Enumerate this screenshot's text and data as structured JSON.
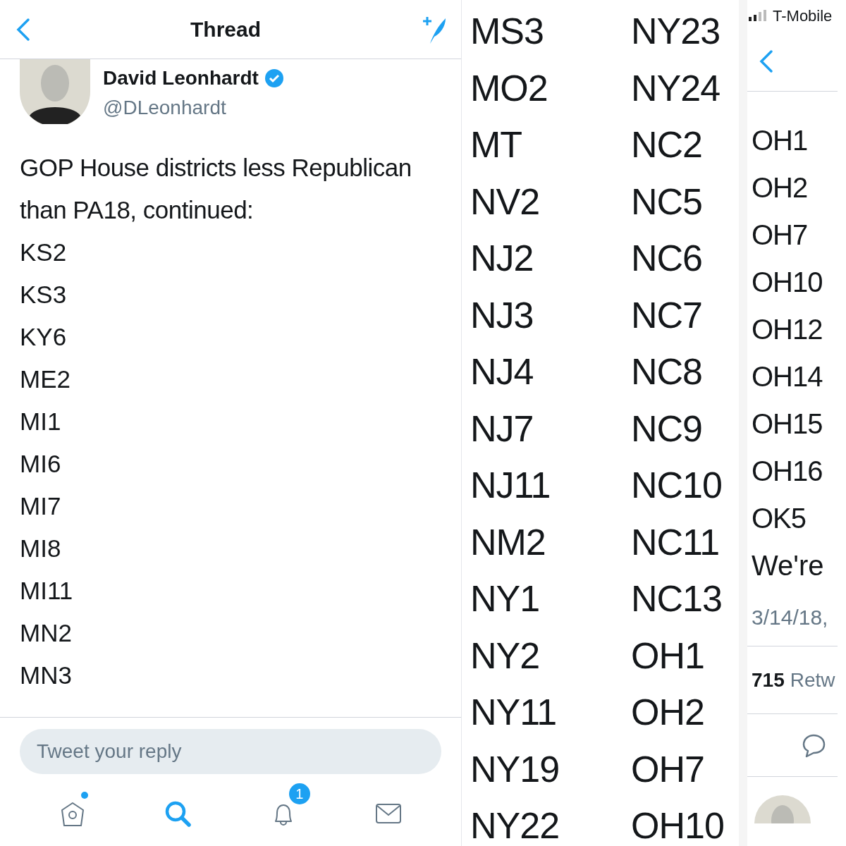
{
  "left_panel": {
    "header": {
      "title": "Thread"
    },
    "tweet": {
      "author": "David Leonhardt",
      "verified": true,
      "handle": "@DLeonhardt",
      "text": "GOP House districts less Republican than PA18, continued:",
      "districts": [
        "KS2",
        "KS3",
        "KY6",
        "ME2",
        "MI1",
        "MI6",
        "MI7",
        "MI8",
        "MI11",
        "MN2",
        "MN3"
      ]
    },
    "reply_box": {
      "placeholder": "Tweet your reply"
    },
    "tab_bar": [
      {
        "kind": "home",
        "selected": false,
        "dot": true
      },
      {
        "kind": "search",
        "selected": true
      },
      {
        "kind": "notifications",
        "selected": false,
        "badge": "1"
      },
      {
        "kind": "messages",
        "selected": false
      }
    ]
  },
  "middle_panel": {
    "column_1": [
      "MS3",
      "MO2",
      "MT",
      "NV2",
      "NJ2",
      "NJ3",
      "NJ4",
      "NJ7",
      "NJ11",
      "NM2",
      "NY1",
      "NY2",
      "NY11",
      "NY19",
      "NY22"
    ],
    "column_2": [
      "NY23",
      "NY24",
      "NC2",
      "NC5",
      "NC6",
      "NC7",
      "NC8",
      "NC9",
      "NC10",
      "NC11",
      "NC13",
      "OH1",
      "OH2",
      "OH7",
      "OH10"
    ]
  },
  "right_panel": {
    "status_bar": {
      "carrier": "T-Mobile"
    },
    "districts": [
      "OH1",
      "OH2",
      "OH7",
      "OH10",
      "OH12",
      "OH14",
      "OH15",
      "OH16",
      "OK5"
    ],
    "text": "We're",
    "timestamp": "3/14/18,",
    "retweets": {
      "count": "715",
      "label": "Retw"
    }
  }
}
